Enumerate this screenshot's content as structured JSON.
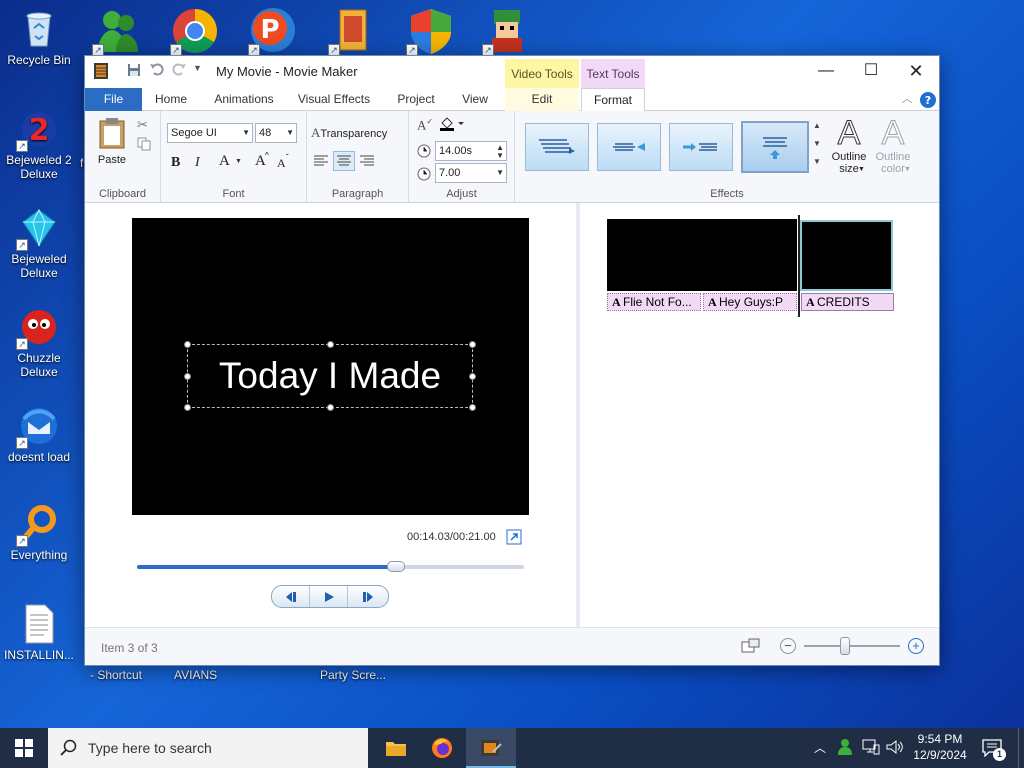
{
  "desktop": {
    "left_icons": [
      {
        "label": "Recycle Bin",
        "icon": "recycle-bin-icon"
      },
      {
        "label": "Bejeweled 2 Deluxe",
        "icon": "bejeweled2-icon"
      },
      {
        "label": "Bejeweled Deluxe",
        "icon": "bejeweled-icon"
      },
      {
        "label": "Chuzzle Deluxe",
        "icon": "chuzzle-icon"
      },
      {
        "label": "doesnt load",
        "icon": "thunderbird-icon"
      },
      {
        "label": "Everything",
        "icon": "everything-search-icon"
      },
      {
        "label": "INSTALLIN...",
        "icon": "text-file-icon"
      }
    ],
    "top_icons": [
      "messenger-icon",
      "chrome-icon",
      "pinball-icon",
      "archive-icon",
      "windows-security-icon",
      "game-character-icon"
    ],
    "behind_labels": [
      "fi",
      "- Shortcut",
      "AVIANS",
      "Party Scre..."
    ]
  },
  "window": {
    "title": "My Movie - Movie Maker",
    "context_tabs": {
      "video_tools": "Video Tools",
      "text_tools": "Text Tools"
    },
    "tabs": [
      "File",
      "Home",
      "Animations",
      "Visual Effects",
      "Project",
      "View",
      "Edit",
      "Format"
    ],
    "ribbon": {
      "clipboard": {
        "paste": "Paste",
        "label": "Clipboard"
      },
      "font": {
        "family": "Segoe UI",
        "size": "48",
        "label": "Font",
        "bold": "B",
        "italic": "I",
        "color": "A",
        "grow": "A",
        "shrink": "A"
      },
      "paragraph": {
        "transparency": "Transparency",
        "label": "Paragraph"
      },
      "adjust": {
        "start_time": "14.00s",
        "duration": "7.00",
        "label": "Adjust"
      },
      "effects": {
        "label": "Effects",
        "outline_size": "Outline size",
        "outline_color": "Outline color"
      }
    },
    "preview": {
      "caption": "Today I Made",
      "timecode": "00:14.03/00:21.00",
      "seek_progress": 0.67
    },
    "storyboard": {
      "captions": [
        "Flie Not Fo...",
        "Hey Guys:P",
        "CREDITS"
      ]
    },
    "status": {
      "item": "Item 3 of 3"
    }
  },
  "taskbar": {
    "search_placeholder": "Type here to search",
    "time": "9:54 PM",
    "date": "12/9/2024",
    "notification_count": "1"
  },
  "colors": {
    "accent": "#2b6cc4",
    "video_tools": "#fdf6a3",
    "text_tools": "#f2d9f6"
  }
}
